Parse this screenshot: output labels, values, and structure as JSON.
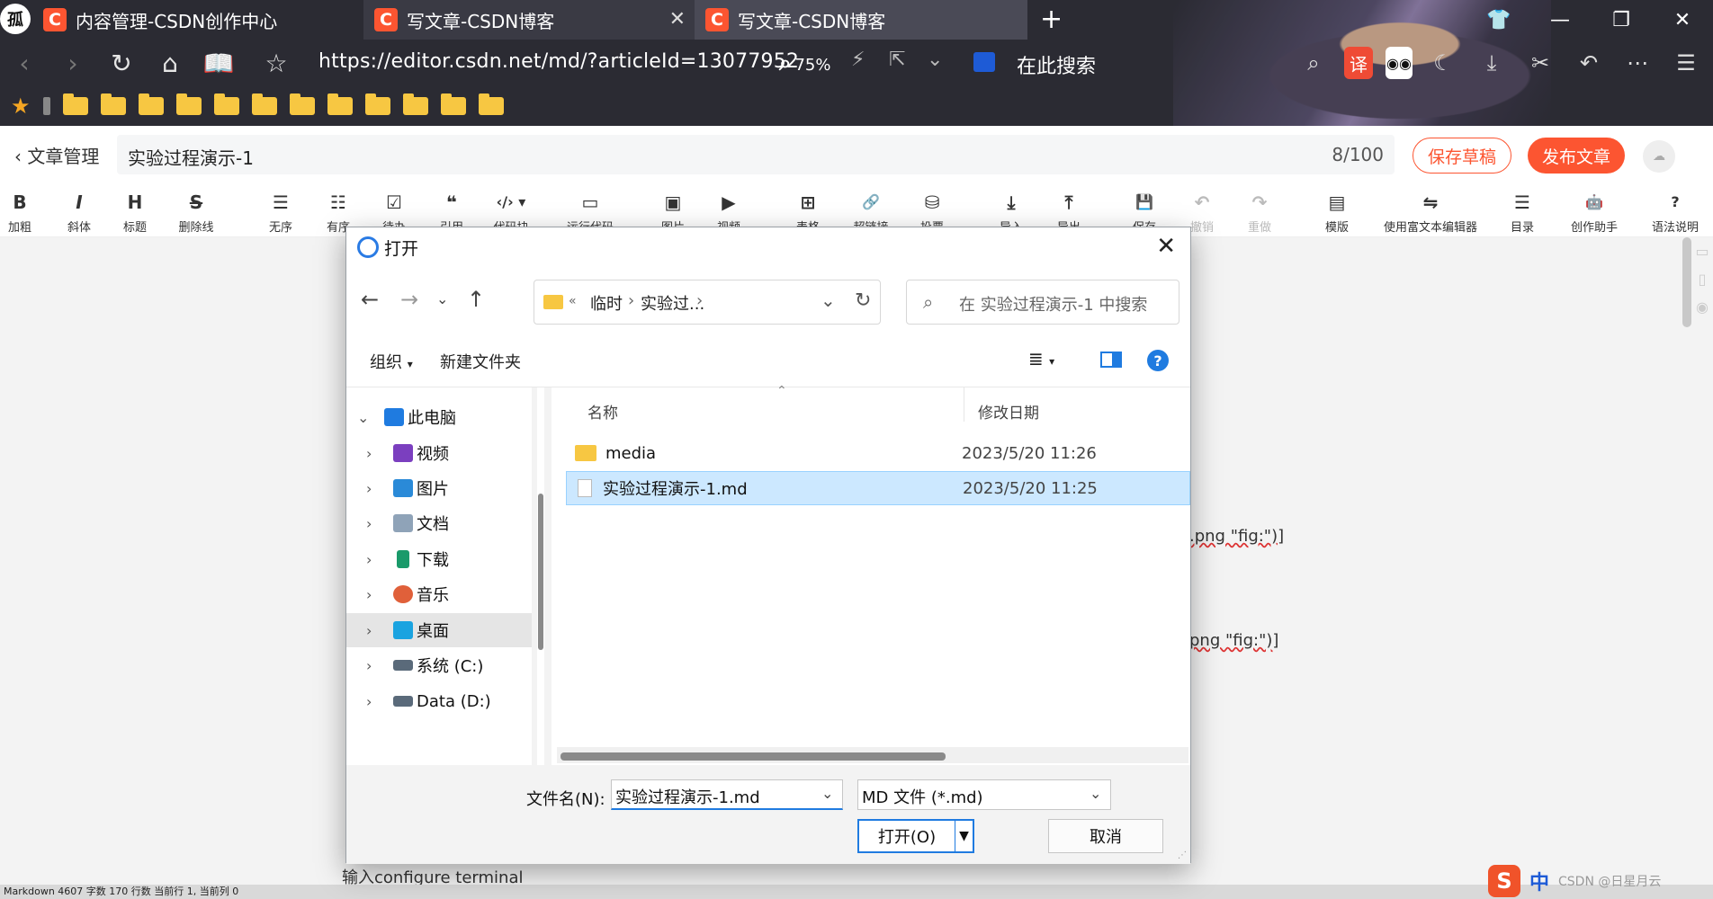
{
  "browser": {
    "tabs": [
      {
        "title": "内容管理-CSDN创作中心"
      },
      {
        "title": "写文章-CSDN博客"
      },
      {
        "title": "写文章-CSDN博客"
      }
    ],
    "tab_avatar": "孤",
    "url": "https://editor.csdn.net/md/?articleId=13077952",
    "zoom": "75%",
    "search_label": "在此搜索",
    "translate_label": "译"
  },
  "editor": {
    "back_label": "文章管理",
    "title": "实验过程演示-1",
    "title_count": "8/100",
    "save_draft": "保存草稿",
    "publish": "发布文章",
    "toolbar": [
      {
        "icon": "B",
        "label": "加粗"
      },
      {
        "icon": "I",
        "label": "斜体"
      },
      {
        "icon": "H",
        "label": "标题"
      },
      {
        "icon": "S",
        "label": "删除线"
      },
      {
        "icon": "☰",
        "label": "无序"
      },
      {
        "icon": "☷",
        "label": "有序"
      },
      {
        "icon": "☑",
        "label": "待办"
      },
      {
        "icon": "❝",
        "label": "引用"
      },
      {
        "icon": "‹/› ▾",
        "label": "代码块"
      },
      {
        "icon": "▭",
        "label": "运行代码"
      },
      {
        "icon": "▣",
        "label": "图片"
      },
      {
        "icon": "▶",
        "label": "视频"
      },
      {
        "icon": "⊞",
        "label": "表格"
      },
      {
        "icon": "🔗",
        "label": "超链接"
      },
      {
        "icon": "⛁",
        "label": "投票"
      },
      {
        "icon": "⤓",
        "label": "导入"
      },
      {
        "icon": "⤒",
        "label": "导出"
      },
      {
        "icon": "💾",
        "label": "保存"
      },
      {
        "icon": "↶",
        "label": "撤销"
      },
      {
        "icon": "↷",
        "label": "重做"
      },
      {
        "icon": "▤",
        "label": "模版"
      },
      {
        "icon": "⇋",
        "label": "使用富文本编辑器"
      },
      {
        "icon": "☰",
        "label": "目录"
      },
      {
        "icon": "🤖",
        "label": "创作助手"
      },
      {
        "icon": "?",
        "label": "语法说明"
      }
    ],
    "fragments": {
      "png1": ".png \"fig:\")]",
      "png2": "png \"fig:\")]",
      "configure": "输入configure terminal"
    },
    "status": "Markdown  4607 字数  170 行数  当前行 1, 当前列 0"
  },
  "ime": {
    "logo": "S",
    "mode": "中",
    "watermark": "CSDN @日星月云"
  },
  "dialog": {
    "title": "打开",
    "breadcrumb": [
      "临时",
      "实验过..."
    ],
    "search_placeholder": "在 实验过程演示-1 中搜索",
    "organize": "组织",
    "new_folder": "新建文件夹",
    "tree": [
      {
        "label": "此电脑",
        "icon": "monitor-icon",
        "color": "#1f7be0"
      },
      {
        "label": "视频",
        "icon": "video-folder-icon",
        "color": "#7b3fbf"
      },
      {
        "label": "图片",
        "icon": "pictures-folder-icon",
        "color": "#2a8ad8"
      },
      {
        "label": "文档",
        "icon": "documents-folder-icon",
        "color": "#8fa3b8"
      },
      {
        "label": "下载",
        "icon": "download-icon",
        "color": "#1a9a6a"
      },
      {
        "label": "音乐",
        "icon": "music-folder-icon",
        "color": "#e0603a"
      },
      {
        "label": "桌面",
        "icon": "desktop-folder-icon",
        "color": "#1aa3e0"
      },
      {
        "label": "系统 (C:)",
        "icon": "drive-icon",
        "color": "#5a6a7a"
      },
      {
        "label": "Data (D:)",
        "icon": "drive-icon",
        "color": "#5a6a7a"
      }
    ],
    "columns": {
      "name": "名称",
      "modified": "修改日期"
    },
    "files": [
      {
        "name": "media",
        "date": "2023/5/20 11:26",
        "type": "folder"
      },
      {
        "name": "实验过程演示-1.md",
        "date": "2023/5/20 11:25",
        "type": "md"
      }
    ],
    "filename_label": "文件名(N):",
    "filename_value": "实验过程演示-1.md",
    "filetype_value": "MD 文件 (*.md)",
    "open_button": "打开(O)",
    "cancel_button": "取消"
  }
}
